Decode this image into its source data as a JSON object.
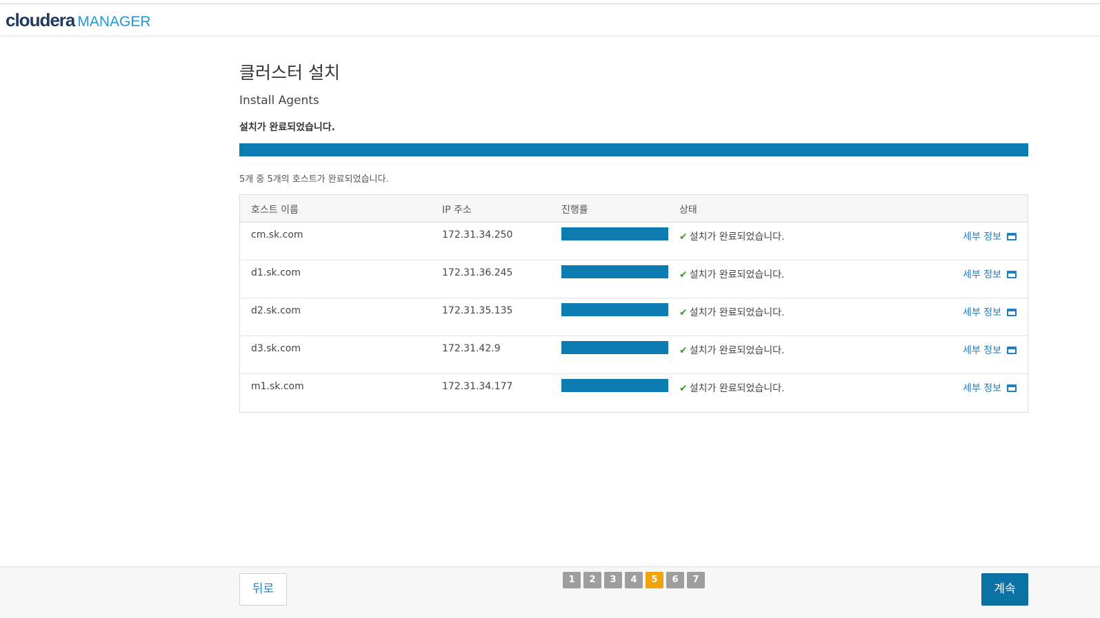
{
  "header": {
    "brand": "cloudera",
    "product": "MANAGER"
  },
  "page": {
    "title": "클러스터 설치",
    "subtitle": "Install Agents",
    "status": "설치가 완료되었습니다.",
    "overall_progress": 1.0,
    "count_text": "5개 중 5개의 호스트가 완료되었습니다."
  },
  "table": {
    "headers": {
      "host": "호스트 이름",
      "ip": "IP 주소",
      "progress": "진행률",
      "state": "상태"
    },
    "rows": [
      {
        "host": "cm.sk.com",
        "ip": "172.31.34.250",
        "progress": 1.0,
        "state": "설치가 완료되었습니다.",
        "details": "세부 정보"
      },
      {
        "host": "d1.sk.com",
        "ip": "172.31.36.245",
        "progress": 1.0,
        "state": "설치가 완료되었습니다.",
        "details": "세부 정보"
      },
      {
        "host": "d2.sk.com",
        "ip": "172.31.35.135",
        "progress": 1.0,
        "state": "설치가 완료되었습니다.",
        "details": "세부 정보"
      },
      {
        "host": "d3.sk.com",
        "ip": "172.31.42.9",
        "progress": 1.0,
        "state": "설치가 완료되었습니다.",
        "details": "세부 정보"
      },
      {
        "host": "m1.sk.com",
        "ip": "172.31.34.177",
        "progress": 1.0,
        "state": "설치가 완료되었습니다.",
        "details": "세부 정보"
      }
    ]
  },
  "footer": {
    "back_label": "뒤로",
    "next_label": "계속",
    "steps": [
      "1",
      "2",
      "3",
      "4",
      "5",
      "6",
      "7"
    ],
    "current_step": "5"
  },
  "colors": {
    "progress": "#0b7bb0",
    "accent": "#1e7fc0",
    "active_step": "#f0a30a",
    "check": "#3c9a2c"
  },
  "icons": {
    "check": "check-icon",
    "details": "window-icon"
  }
}
